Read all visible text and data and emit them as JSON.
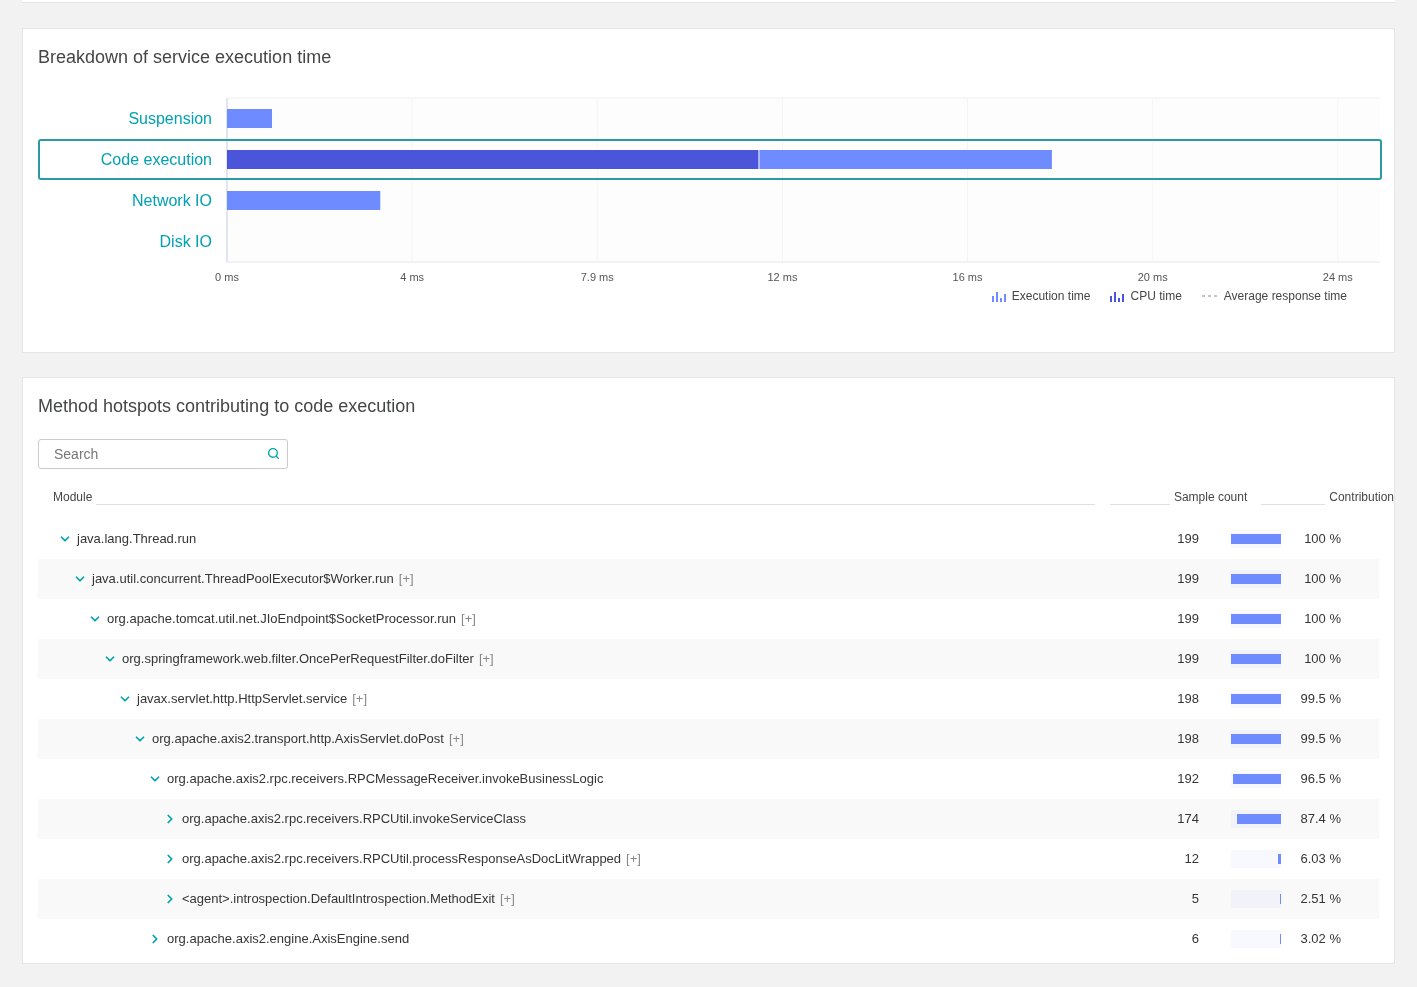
{
  "breakdown": {
    "title": "Breakdown of service execution time",
    "category_selected": [
      false,
      true,
      false,
      false
    ],
    "chart_data": {
      "type": "bar",
      "orientation": "horizontal",
      "stacked": true,
      "categories": [
        "Suspension",
        "Code execution",
        "Network IO",
        "Disk IO"
      ],
      "series": [
        {
          "name": "Execution time",
          "color": "#6e8cff",
          "values": [
            0.96,
            6.24,
            3.27,
            0
          ]
        },
        {
          "name": "CPU time",
          "color": "#4a55d9",
          "values": [
            0,
            11.36,
            0,
            0
          ]
        },
        {
          "name": "Average response time",
          "color": "#c4c4c4",
          "values": [
            null,
            null,
            null,
            null
          ]
        }
      ],
      "grid": true,
      "legend": true,
      "xlim": [
        0,
        24.6
      ],
      "xticks": [
        {
          "value": 0,
          "label": "0 ms"
        },
        {
          "value": 3.95,
          "label": "4 ms"
        },
        {
          "value": 7.9,
          "label": "7.9 ms"
        },
        {
          "value": 11.85,
          "label": "12 ms"
        },
        {
          "value": 15.8,
          "label": "16 ms"
        },
        {
          "value": 19.75,
          "label": "20 ms"
        },
        {
          "value": 23.7,
          "label": "24 ms"
        }
      ]
    }
  },
  "hotspots": {
    "title": "Method hotspots contributing to code execution",
    "search": {
      "placeholder": "Search"
    },
    "columns": [
      "Module",
      "Sample count",
      "Contribution"
    ],
    "rows": [
      {
        "name": "java.lang.Thread.run",
        "expanded": true,
        "samples": "199",
        "level": 1,
        "contribution": "100 %",
        "children": [
          {
            "name": "java.util.concurrent.ThreadPoolExecutor$Worker.run",
            "more": "[+]",
            "expanded": true,
            "samples": "199",
            "level": 1,
            "contribution": "100 %",
            "children": [
              {
                "name": "org.apache.tomcat.util.net.JIoEndpoint$SocketProcessor.run",
                "more": "[+]",
                "expanded": true,
                "samples": "199",
                "level": 1,
                "contribution": "100 %",
                "children": [
                  {
                    "name": "org.springframework.web.filter.OncePerRequestFilter.doFilter",
                    "more": "[+]",
                    "expanded": true,
                    "samples": "199",
                    "level": 1,
                    "contribution": "100 %",
                    "children": [
                      {
                        "name": "javax.servlet.http.HttpServlet.service",
                        "more": "[+]",
                        "expanded": true,
                        "samples": "198",
                        "level": 0.995,
                        "contribution": "99.5 %",
                        "children": [
                          {
                            "name": "org.apache.axis2.transport.http.AxisServlet.doPost",
                            "more": "[+]",
                            "expanded": true,
                            "samples": "198",
                            "level": 0.995,
                            "contribution": "99.5 %",
                            "children": [
                              {
                                "name": "org.apache.axis2.rpc.receivers.RPCMessageReceiver.invokeBusinessLogic",
                                "expanded": true,
                                "samples": "192",
                                "level": 0.965,
                                "contribution": "96.5 %",
                                "children": [
                                  {
                                    "name": "org.apache.axis2.rpc.receivers.RPCUtil.invokeServiceClass",
                                    "expanded": false,
                                    "samples": "174",
                                    "level": 0.874,
                                    "contribution": "87.4 %"
                                  },
                                  {
                                    "name": "org.apache.axis2.rpc.receivers.RPCUtil.processResponseAsDocLitWrapped",
                                    "more": "[+]",
                                    "expanded": false,
                                    "samples": "12",
                                    "level": 0.0603,
                                    "contribution": "6.03 %"
                                  },
                                  {
                                    "name": "<agent>.introspection.DefaultIntrospection.MethodExit",
                                    "more": "[+]",
                                    "expanded": false,
                                    "samples": "5",
                                    "level": 0.0251,
                                    "contribution": "2.51 %"
                                  }
                                ]
                              },
                              {
                                "name": "org.apache.axis2.engine.AxisEngine.send",
                                "expanded": false,
                                "samples": "6",
                                "level": 0.0302,
                                "contribution": "3.02 %"
                              }
                            ]
                          }
                        ]
                      }
                    ]
                  }
                ]
              }
            ]
          }
        ]
      }
    ]
  }
}
